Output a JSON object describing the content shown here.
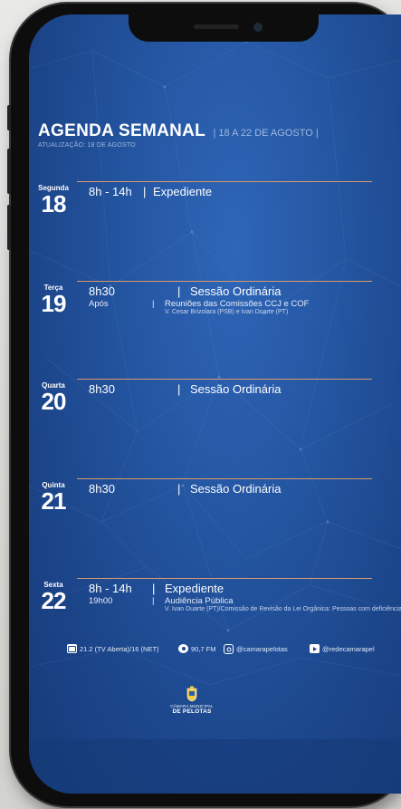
{
  "header": {
    "title": "AGENDA SEMANAL",
    "range": "| 18 A 22 DE AGOSTO |",
    "updated": "ATUALIZAÇÃO: 18 DE AGOSTO"
  },
  "days": [
    {
      "name": "Segunda",
      "number": "18",
      "time": "8h - 14h",
      "separator": "|",
      "event": "Expediente"
    },
    {
      "name": "Terça",
      "number": "19",
      "time": "8h30",
      "separator": "|",
      "event": "Sessão Ordinária",
      "time2": "Após",
      "separator2": "|",
      "event2": "Reuniões das Comissões CCJ e COF",
      "note": "V. Cesar Brizolara (PSB) e Ivan Duarte (PT)"
    },
    {
      "name": "Quarta",
      "number": "20",
      "time": "8h30",
      "separator": "|",
      "event": "Sessão Ordinária"
    },
    {
      "name": "Quinta",
      "number": "21",
      "time": "8h30",
      "separator": "|",
      "event": "Sessão Ordinária"
    },
    {
      "name": "Sexta",
      "number": "22",
      "time": "8h - 14h",
      "separator": "|",
      "event": "Expediente",
      "time2": "19h00",
      "separator2": "|",
      "event2": "Audiência Pública",
      "note": "V. Ivan Duarte (PT)/Comissão de Revisão da Lei Orgânica: Pessoas com deficiência"
    }
  ],
  "footer": {
    "tv": "21.2 (TV Aberta)/16 (NET)",
    "radio": "90,7 FM",
    "instagram": "@camarapelotas",
    "youtube": "@redecamarapel"
  },
  "logo": {
    "line1": "CÂMARA MUNICIPAL",
    "line2": "DE PELOTAS"
  },
  "colors": {
    "background": "#23549f",
    "accent_rule": "#d99a6c",
    "muted_text": "#9fb8df"
  },
  "icons": [
    "tv-icon",
    "radio-icon",
    "instagram-icon",
    "youtube-icon",
    "city-crest-icon"
  ]
}
